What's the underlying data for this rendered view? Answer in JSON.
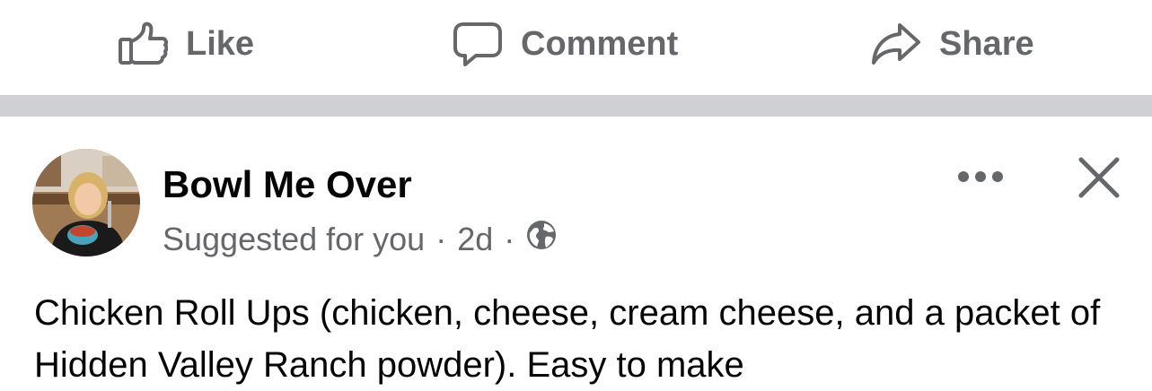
{
  "actions": {
    "like_label": "Like",
    "comment_label": "Comment",
    "share_label": "Share"
  },
  "post": {
    "author": "Bowl Me Over",
    "meta_suggested": "Suggested for you",
    "meta_separator": "·",
    "meta_time": "2d",
    "audience_icon": "globe-icon",
    "text": "Chicken Roll Ups (chicken, cheese, cream cheese, and a packet of Hidden Valley Ranch powder). Easy to make"
  },
  "colors": {
    "secondary_text": "#65676b",
    "primary_text": "#050505",
    "separator": "#ced0d4"
  }
}
